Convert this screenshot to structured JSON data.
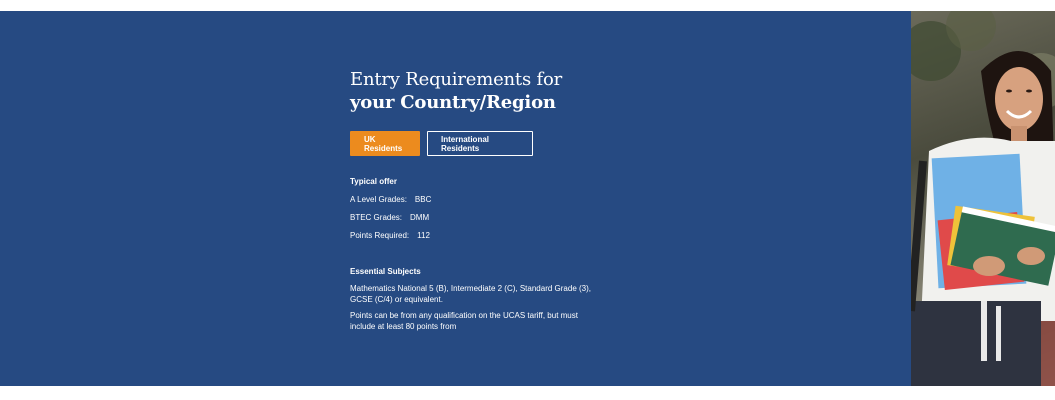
{
  "entry": {
    "title_line1": "Entry Requirements for",
    "title_line2": "your Country/Region",
    "buttons": {
      "uk": "UK Residents",
      "international": "International Residents"
    },
    "typical_offer": {
      "heading": "Typical offer",
      "rows": [
        {
          "label": "A Level Grades:",
          "value": "BBC"
        },
        {
          "label": "BTEC Grades:",
          "value": "DMM"
        },
        {
          "label": "Points Required:",
          "value": "112"
        }
      ]
    },
    "essential_subjects": {
      "heading": "Essential Subjects",
      "paragraph1": "Mathematics National 5 (B), Intermediate 2 (C), Standard Grade (3), GCSE (C/4) or equivalent.",
      "paragraph2": "Points can be from any qualification on the UCAS tariff, but must include at least 80 points from"
    }
  },
  "colors": {
    "section_bg": "#264a82",
    "accent": "#ec8b1e"
  }
}
